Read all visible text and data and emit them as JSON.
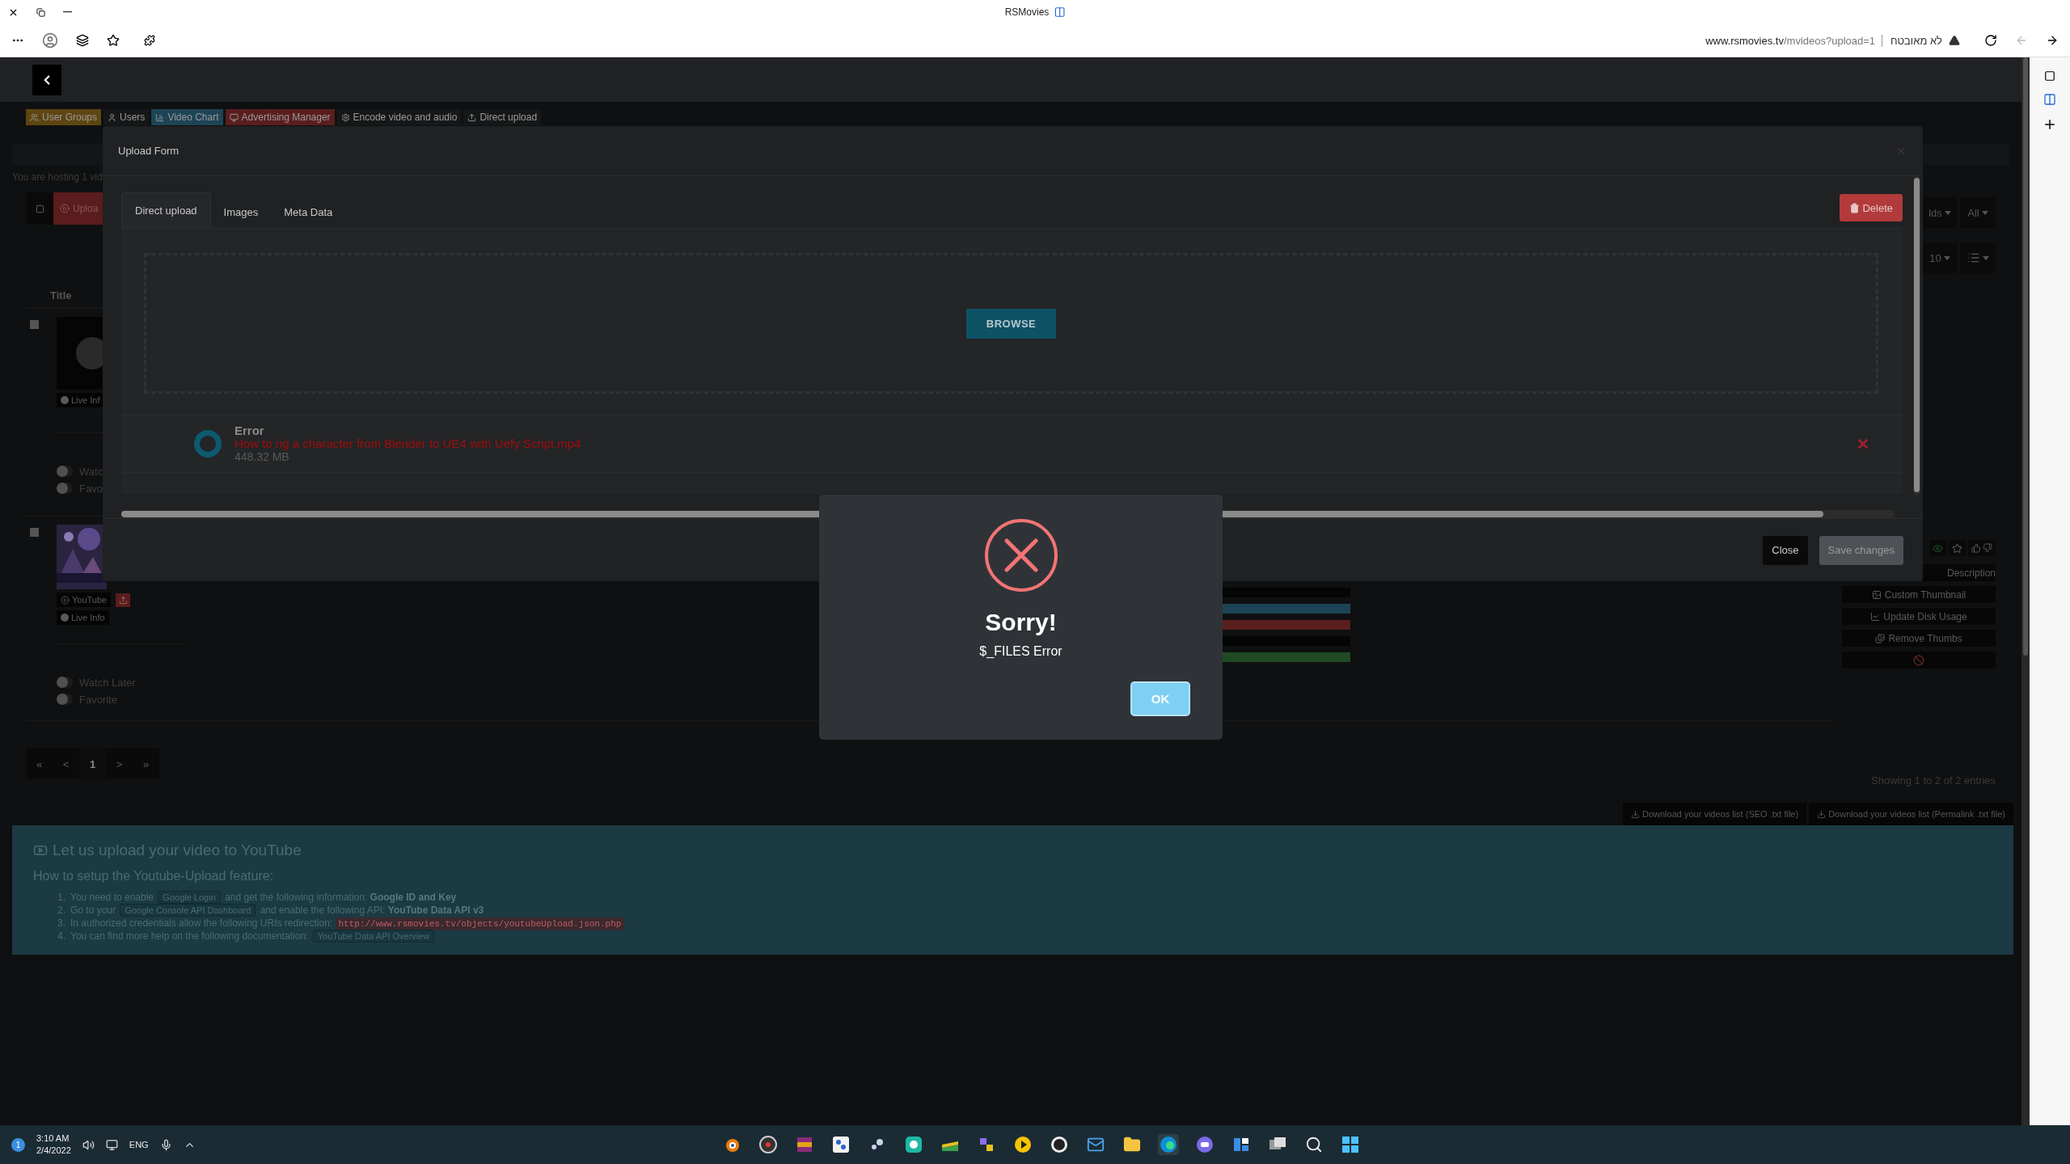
{
  "browser": {
    "title": "RSMovies",
    "url_host": "www.rsmovies.tv",
    "url_path": "/mvideos?upload=1",
    "security": "לא מאובטח"
  },
  "admin_menu": [
    {
      "label": "User Groups",
      "color": "#5e4512"
    },
    {
      "label": "Users",
      "color": "#161718"
    },
    {
      "label": "Video Chart",
      "color": "#1d4456"
    },
    {
      "label": "Advertising Manager",
      "color": "#5a1e1e"
    },
    {
      "label": "Encode video and audio",
      "color": "#161718"
    },
    {
      "label": "Direct upload",
      "color": "#161718"
    }
  ],
  "hosting_note": "You are hosting 1 vid",
  "upload_button": "Uploa",
  "title_header": "Title",
  "rows": [
    {
      "kind": "player",
      "checked": false,
      "live_info": "Live Inf",
      "watch_later": "Watc",
      "favorite": "Favo"
    },
    {
      "kind": "picture",
      "checked": false,
      "source": "YouTube",
      "live_info": "Live Info",
      "watch_later": "Watch Later",
      "favorite": "Favorite"
    }
  ],
  "pagination": [
    {
      "label": "«",
      "selected": false
    },
    {
      "label": "<",
      "selected": false
    },
    {
      "label": "1",
      "selected": true
    },
    {
      "label": ">",
      "selected": false
    },
    {
      "label": "»",
      "selected": false
    }
  ],
  "filters": [
    [
      "lds",
      "All"
    ],
    [
      "10"
    ]
  ],
  "row_actions": [
    "Description",
    "Custom Thumbnail",
    "Update Disk Usage",
    "Remove Thumbs"
  ],
  "entries_info": "Showing 1 to 2 of 2 entries",
  "downloads": [
    "Download your videos list (SEO .txt file)",
    "Download your videos list (Permalink .txt file)"
  ],
  "youtube_help": {
    "title": "Let us upload your video to YouTube",
    "subtitle": "How to setup the Youtube-Upload feature:",
    "steps": [
      {
        "number": "1.",
        "parts": [
          {
            "kind": "text",
            "text": "You need to enable "
          },
          {
            "kind": "button",
            "text": "Google Login"
          },
          {
            "kind": "text",
            "text": " and get the following information: **Google ID and Key**"
          }
        ]
      },
      {
        "number": "2.",
        "parts": [
          {
            "kind": "text",
            "text": "Go to your "
          },
          {
            "kind": "button",
            "text": "Google Console API Dashboard"
          },
          {
            "kind": "text",
            "text": " and enable the following API: **YouTube Data API v3**"
          }
        ]
      },
      {
        "number": "3.",
        "parts": [
          {
            "kind": "text",
            "text": "In authorized credentials allow the following URIs redirection: "
          },
          {
            "kind": "code",
            "text": "http://www.rsmovies.tv/objects/youtubeUpload.json.php"
          }
        ]
      },
      {
        "number": "4.",
        "parts": [
          {
            "kind": "text",
            "text": "You can find more help on the following documentation: "
          },
          {
            "kind": "button",
            "text": "YouTube Data API Overview"
          }
        ]
      }
    ]
  },
  "modal": {
    "title": "Upload Form",
    "tabs": [
      {
        "label": "Direct upload",
        "selected": true
      },
      {
        "label": "Images",
        "selected": false
      },
      {
        "label": "Meta Data",
        "selected": false
      }
    ],
    "delete": "Delete",
    "browse": "BROWSE",
    "file": {
      "status": "Error",
      "name": "How to rig a character from Blender to UE4 with Uefy Script.mp4",
      "size": "448.32 MB"
    },
    "close": "Close",
    "save": "Save changes"
  },
  "alert": {
    "title": "Sorry!",
    "message": "$_FILES Error",
    "ok": "OK"
  },
  "taskbar": {
    "notifications": "1",
    "time": "3:10 AM",
    "date": "2/4/2022",
    "language": "ENG"
  }
}
